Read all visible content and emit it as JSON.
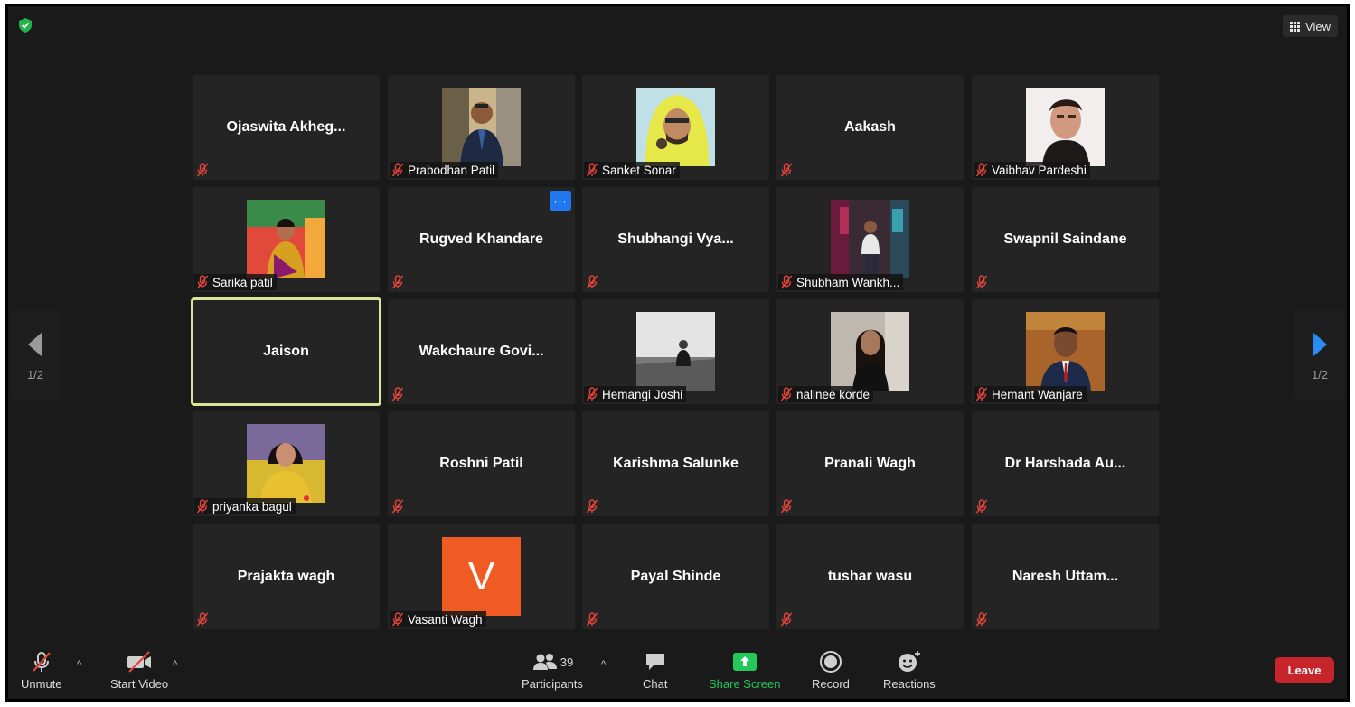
{
  "header": {
    "view_label": "View"
  },
  "pagination": {
    "left_page": "1/2",
    "right_page": "1/2"
  },
  "tiles": [
    {
      "name": "Ojaswita  Akheg...",
      "mode": "center"
    },
    {
      "name": "Prabodhan Patil",
      "mode": "photo",
      "photo": "man-suit"
    },
    {
      "name": "Sanket Sonar",
      "mode": "photo",
      "photo": "yellow-hood"
    },
    {
      "name": "Aakash",
      "mode": "center"
    },
    {
      "name": "Vaibhav Pardeshi",
      "mode": "photo",
      "photo": "selfie-dark"
    },
    {
      "name": "Sarika patil",
      "mode": "photo",
      "photo": "saree-colorful"
    },
    {
      "name": "Rugved Khandare",
      "mode": "center",
      "menu": true
    },
    {
      "name": "Shubhangi  Vya...",
      "mode": "center"
    },
    {
      "name": "Shubham Wankh...",
      "mode": "photo",
      "photo": "street-night"
    },
    {
      "name": "Swapnil Saindane",
      "mode": "center"
    },
    {
      "name": "Jaison",
      "mode": "center",
      "active": true,
      "nomic": true
    },
    {
      "name": "Wakchaure  Govi...",
      "mode": "center"
    },
    {
      "name": "Hemangi Joshi",
      "mode": "photo",
      "photo": "bw-field"
    },
    {
      "name": "nalinee korde",
      "mode": "photo",
      "photo": "woman-black"
    },
    {
      "name": "Hemant Wanjare",
      "mode": "photo",
      "photo": "man-brown"
    },
    {
      "name": "priyanka bagul",
      "mode": "photo",
      "photo": "yellow-selfie"
    },
    {
      "name": "Roshni Patil",
      "mode": "center"
    },
    {
      "name": "Karishma Salunke",
      "mode": "center"
    },
    {
      "name": "Pranali Wagh",
      "mode": "center"
    },
    {
      "name": "Dr Harshada Au...",
      "mode": "center"
    },
    {
      "name": "Prajakta wagh",
      "mode": "center"
    },
    {
      "name": "Vasanti Wagh",
      "mode": "avatar",
      "initial": "V"
    },
    {
      "name": "Payal Shinde",
      "mode": "center"
    },
    {
      "name": "tushar wasu",
      "mode": "center"
    },
    {
      "name": "Naresh Uttam...",
      "mode": "center"
    }
  ],
  "toolbar": {
    "unmute": "Unmute",
    "start_video": "Start Video",
    "participants": "Participants",
    "participants_count": "39",
    "chat": "Chat",
    "share_screen": "Share Screen",
    "record": "Record",
    "reactions": "Reactions",
    "leave": "Leave"
  },
  "colors": {
    "active_speaker": "#d9e69a",
    "share_green": "#24c75a",
    "leave_red": "#c6262b",
    "mute_red": "#e0443a",
    "avatar_orange": "#f05a23"
  }
}
